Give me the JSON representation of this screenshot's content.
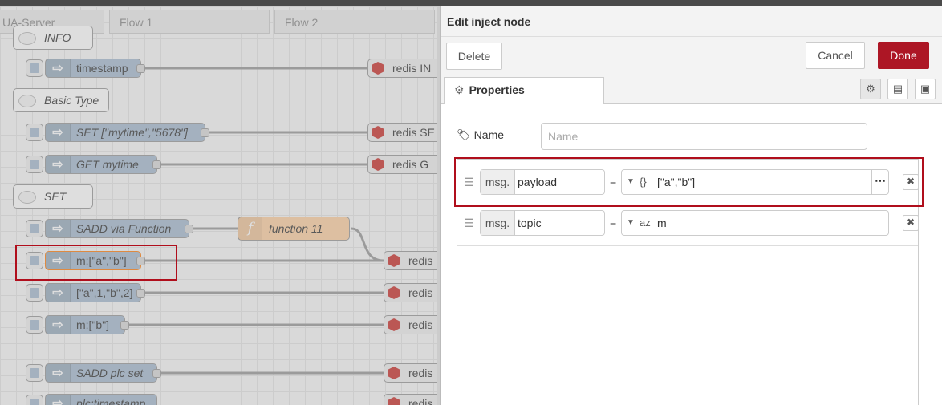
{
  "workspace": {
    "tabs": [
      "UA-Server",
      "Flow 1",
      "Flow 2"
    ],
    "comments": [
      "INFO",
      "Basic Type",
      "SET"
    ],
    "nodes": [
      {
        "label": "timestamp",
        "italic": false
      },
      {
        "label": "SET [\"mytime\",\"5678\"]",
        "italic": true
      },
      {
        "label": "GET mytime",
        "italic": true
      },
      {
        "label": "SADD via Function",
        "italic": true
      },
      {
        "label": "m:[\"a\",\"b\"]",
        "italic": false
      },
      {
        "label": "[\"a\",1,\"b\",2]",
        "italic": false
      },
      {
        "label": "m:[\"b\"]",
        "italic": false
      },
      {
        "label": "SADD plc set",
        "italic": true
      },
      {
        "label": "plc:timestamp",
        "italic": true
      }
    ],
    "function_node": "function 11",
    "redis_nodes": [
      "redis IN",
      "redis SE",
      "redis G",
      "redis",
      "redis",
      "redis",
      "redis",
      "redis"
    ]
  },
  "editor": {
    "title": "Edit inject node",
    "delete_label": "Delete",
    "cancel_label": "Cancel",
    "done_label": "Done",
    "properties_tab": "Properties",
    "name_label": "Name",
    "name_placeholder": "Name",
    "rows": [
      {
        "prefix": "msg.",
        "property": "payload",
        "equals": "=",
        "type_icon": "{}",
        "value": "[\"a\",\"b\"]"
      },
      {
        "prefix": "msg.",
        "property": "topic",
        "equals": "=",
        "type_icon": "az",
        "value": "m"
      }
    ]
  },
  "colors": {
    "accent": "#ad1625",
    "highlight": "#b00e1c",
    "inject": "#a6bbcf",
    "function": "#fdd0a2"
  }
}
